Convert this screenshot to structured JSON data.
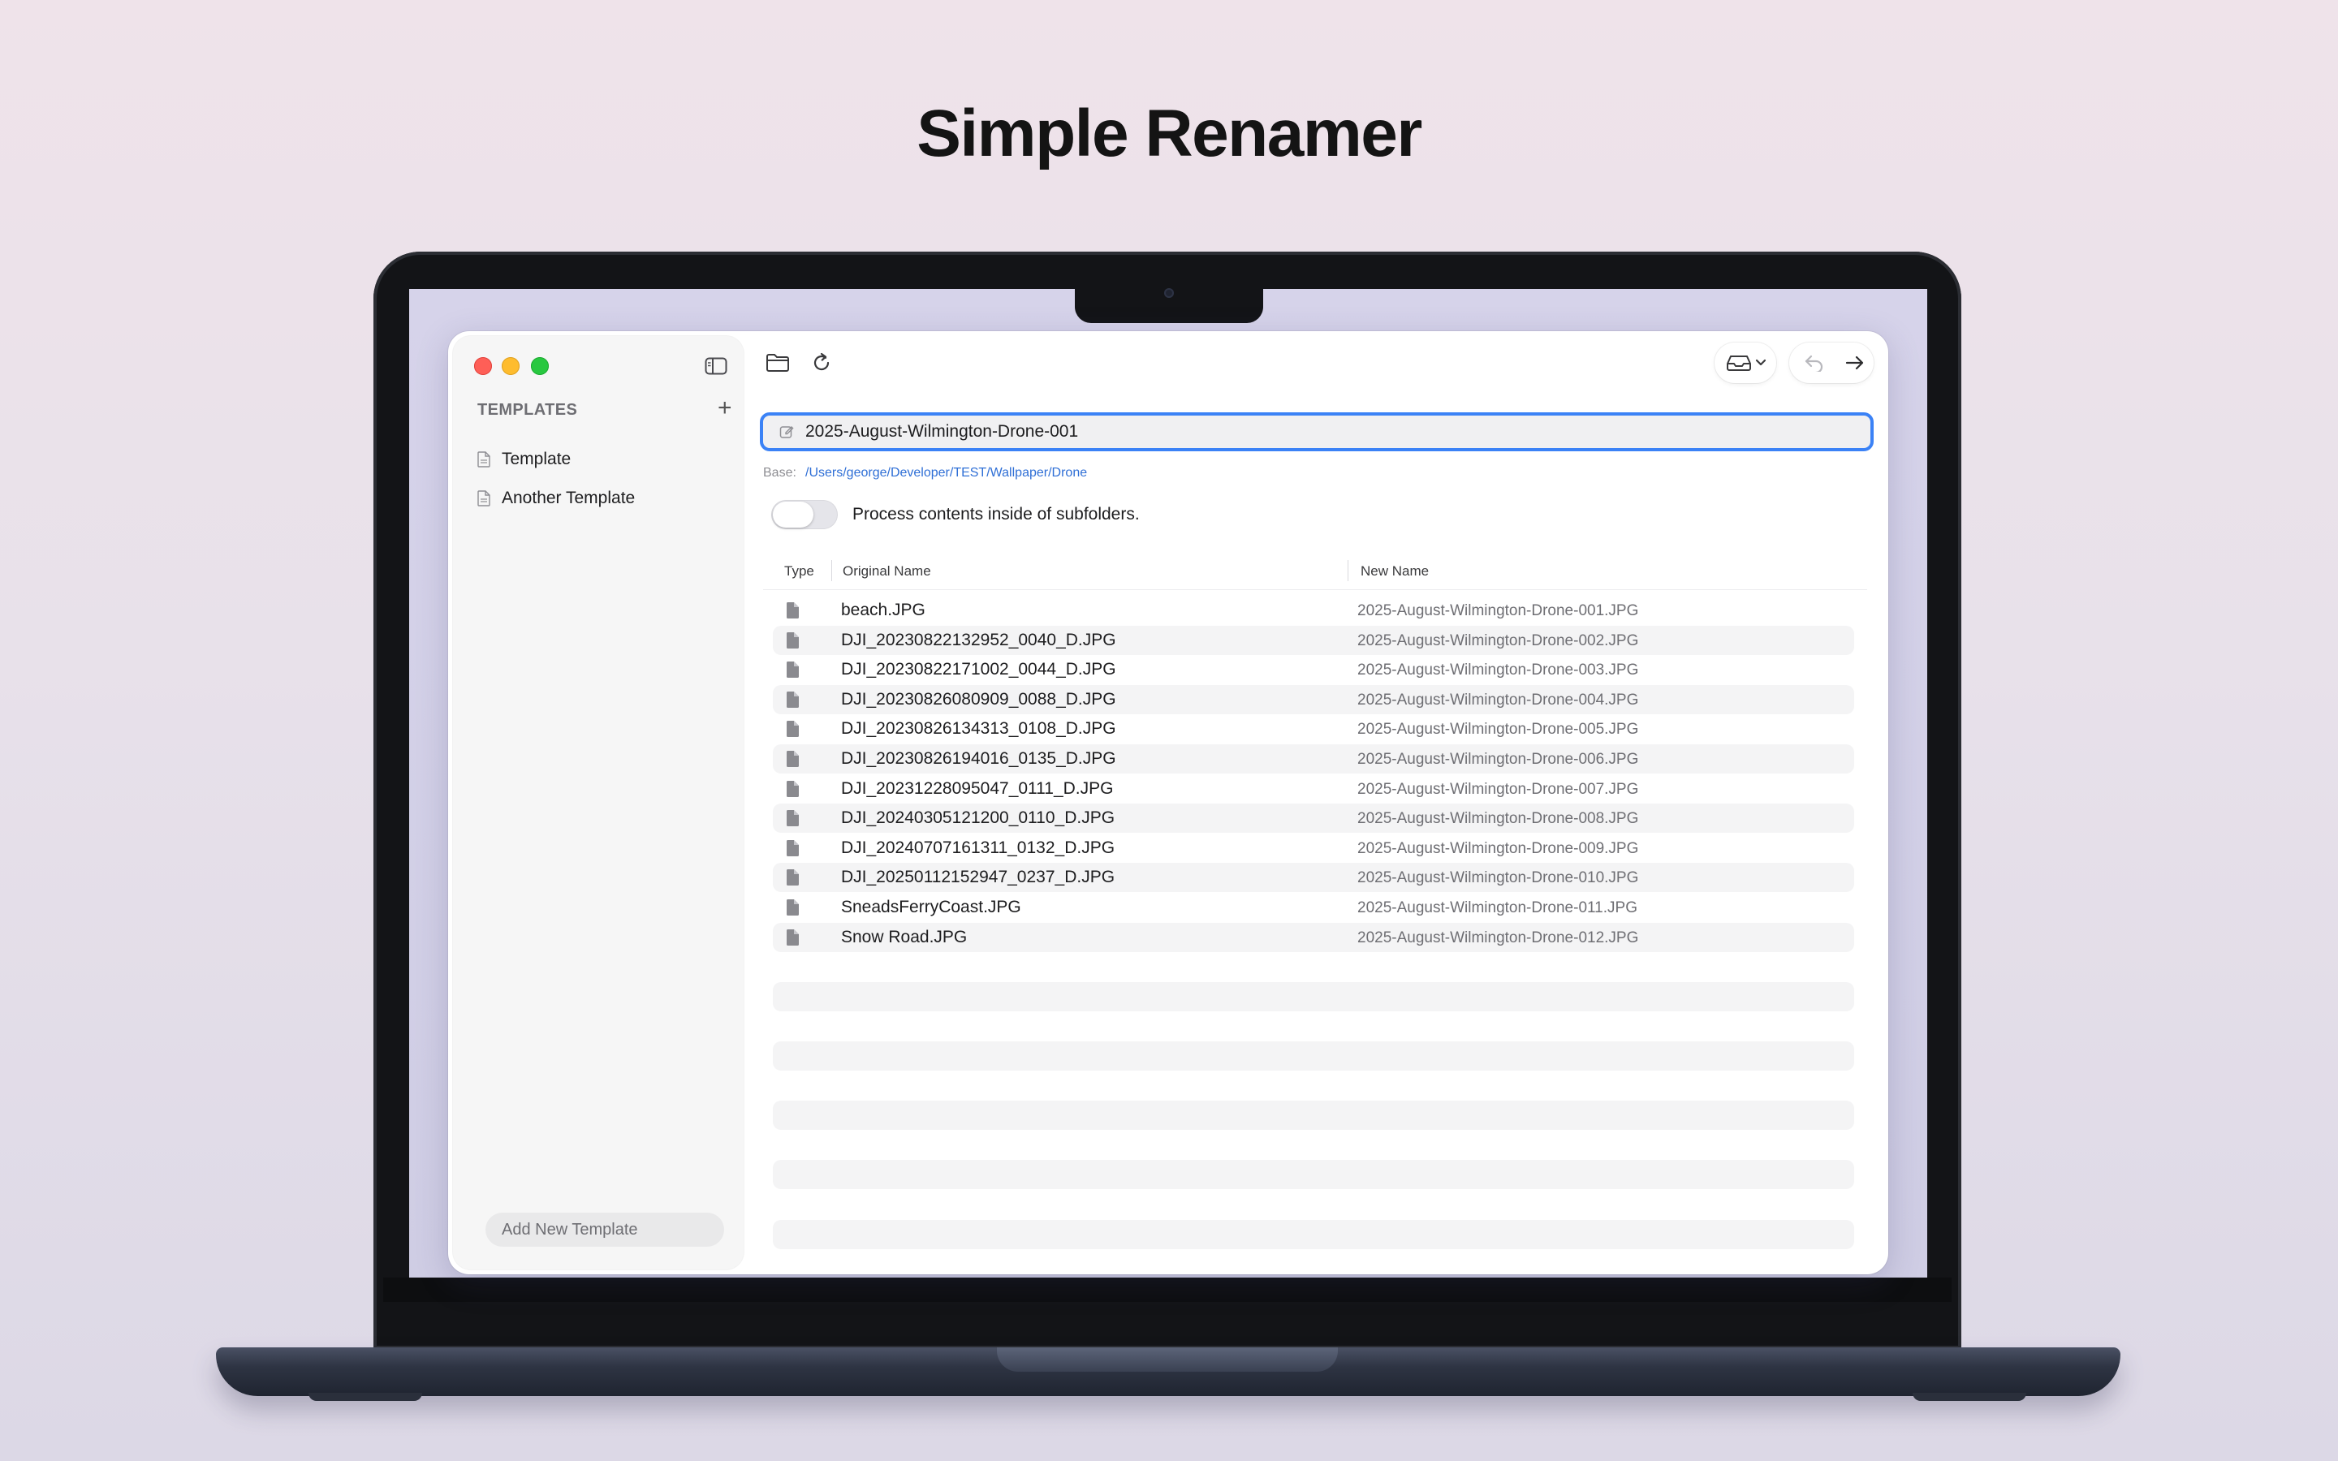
{
  "hero": {
    "title": "Simple Renamer"
  },
  "sidebar": {
    "header": "TEMPLATES",
    "items": [
      {
        "label": "Template"
      },
      {
        "label": "Another Template"
      }
    ],
    "add_button": "Add New Template"
  },
  "toolbar": {
    "icons": [
      "folder-icon",
      "refresh-icon",
      "tray-icon",
      "chevron-down-icon",
      "undo-icon",
      "arrow-right-icon"
    ]
  },
  "template_field": {
    "value": "2025-August-Wilmington-Drone-001"
  },
  "base": {
    "label": "Base:",
    "path": "/Users/george/Developer/TEST/Wallpaper/Drone"
  },
  "subfolders": {
    "label": "Process contents inside of subfolders.",
    "enabled": false
  },
  "table": {
    "columns": [
      "Type",
      "Original Name",
      "New Name"
    ],
    "rows": [
      {
        "original": "beach.JPG",
        "new": "2025-August-Wilmington-Drone-001.JPG"
      },
      {
        "original": "DJI_20230822132952_0040_D.JPG",
        "new": "2025-August-Wilmington-Drone-002.JPG"
      },
      {
        "original": "DJI_20230822171002_0044_D.JPG",
        "new": "2025-August-Wilmington-Drone-003.JPG"
      },
      {
        "original": "DJI_20230826080909_0088_D.JPG",
        "new": "2025-August-Wilmington-Drone-004.JPG"
      },
      {
        "original": "DJI_20230826134313_0108_D.JPG",
        "new": "2025-August-Wilmington-Drone-005.JPG"
      },
      {
        "original": "DJI_20230826194016_0135_D.JPG",
        "new": "2025-August-Wilmington-Drone-006.JPG"
      },
      {
        "original": "DJI_20231228095047_0111_D.JPG",
        "new": "2025-August-Wilmington-Drone-007.JPG"
      },
      {
        "original": "DJI_20240305121200_0110_D.JPG",
        "new": "2025-August-Wilmington-Drone-008.JPG"
      },
      {
        "original": "DJI_20240707161311_0132_D.JPG",
        "new": "2025-August-Wilmington-Drone-009.JPG"
      },
      {
        "original": "DJI_20250112152947_0237_D.JPG",
        "new": "2025-August-Wilmington-Drone-010.JPG"
      },
      {
        "original": "SneadsFerryCoast.JPG",
        "new": "2025-August-Wilmington-Drone-011.JPG"
      },
      {
        "original": "Snow Road.JPG",
        "new": "2025-August-Wilmington-Drone-012.JPG"
      }
    ]
  },
  "colors": {
    "accent": "#3b82f6",
    "path_link": "#2f6fd6",
    "close": "#fe5f57",
    "minimize": "#febc2e",
    "zoom": "#28c840"
  }
}
